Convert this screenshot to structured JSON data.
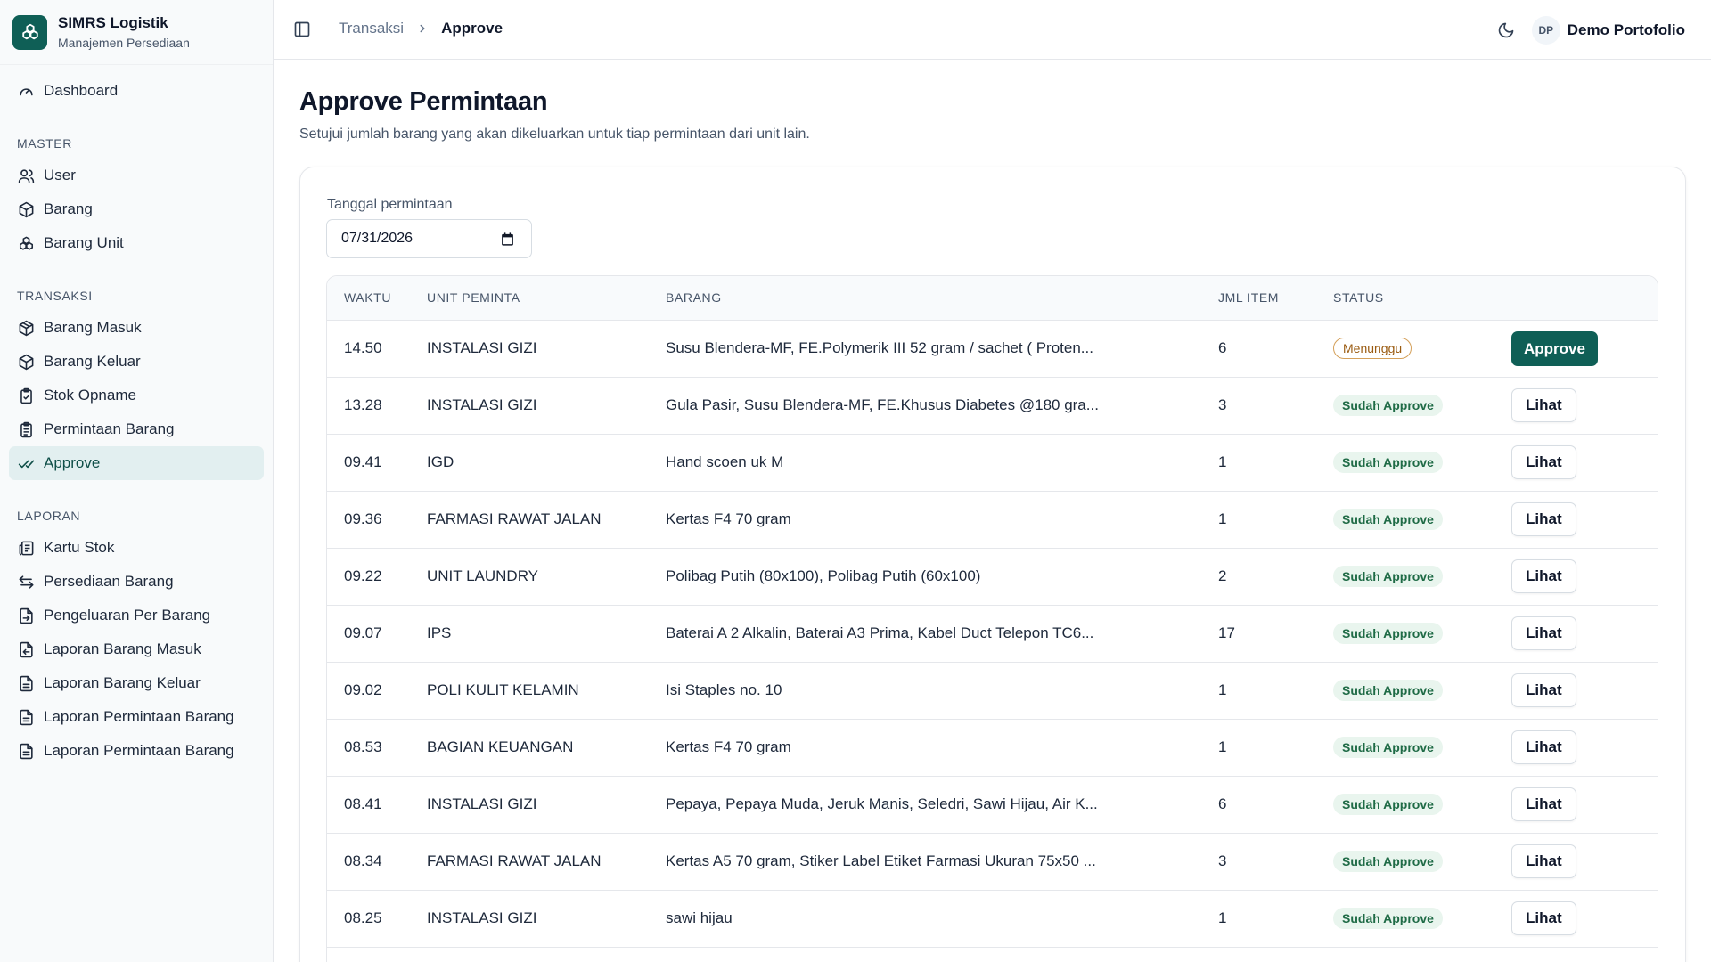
{
  "brand": {
    "title": "SIMRS Logistik",
    "subtitle": "Manajemen Persediaan"
  },
  "sidebar": {
    "dashboard": "Dashboard",
    "sections": {
      "master": "MASTER",
      "transaksi": "TRANSAKSI",
      "laporan": "LAPORAN"
    },
    "master_items": [
      "User",
      "Barang",
      "Barang Unit"
    ],
    "transaksi_items": [
      "Barang Masuk",
      "Barang Keluar",
      "Stok Opname",
      "Permintaan Barang",
      "Approve"
    ],
    "laporan_items": [
      "Kartu Stok",
      "Persediaan Barang",
      "Pengeluaran Per Barang",
      "Laporan Barang Masuk",
      "Laporan Barang Keluar",
      "Laporan Permintaan Barang",
      "Laporan Permintaan Barang"
    ]
  },
  "header": {
    "breadcrumb_prev": "Transaksi",
    "breadcrumb_current": "Approve",
    "user_initials": "DP",
    "user_name": "Demo Portofolio"
  },
  "main": {
    "title": "Approve Permintaan",
    "subtitle": "Setujui jumlah barang yang akan dikeluarkan untuk tiap permintaan dari unit lain.",
    "filter_label": "Tanggal permintaan",
    "filter_value": "07/31/2026"
  },
  "table": {
    "columns": [
      "WAKTU",
      "UNIT PEMINTA",
      "BARANG",
      "JML ITEM",
      "STATUS"
    ],
    "rows": [
      {
        "waktu": "14.50",
        "unit": "INSTALASI GIZI",
        "barang": "Susu Blendera-MF, FE.Polymerik III 52 gram / sachet ( Proten...",
        "jml": "6",
        "status": "Menunggu",
        "action": "Approve"
      },
      {
        "waktu": "13.28",
        "unit": "INSTALASI GIZI",
        "barang": "Gula Pasir, Susu Blendera-MF, FE.Khusus Diabetes @180 gra...",
        "jml": "3",
        "status": "Sudah Approve",
        "action": "Lihat"
      },
      {
        "waktu": "09.41",
        "unit": "IGD",
        "barang": "Hand scoen uk M",
        "jml": "1",
        "status": "Sudah Approve",
        "action": "Lihat"
      },
      {
        "waktu": "09.36",
        "unit": "FARMASI RAWAT JALAN",
        "barang": "Kertas F4 70 gram",
        "jml": "1",
        "status": "Sudah Approve",
        "action": "Lihat"
      },
      {
        "waktu": "09.22",
        "unit": "UNIT LAUNDRY",
        "barang": "Polibag Putih (80x100), Polibag Putih (60x100)",
        "jml": "2",
        "status": "Sudah Approve",
        "action": "Lihat"
      },
      {
        "waktu": "09.07",
        "unit": "IPS",
        "barang": "Baterai A 2 Alkalin, Baterai A3 Prima, Kabel Duct Telepon TC6...",
        "jml": "17",
        "status": "Sudah Approve",
        "action": "Lihat"
      },
      {
        "waktu": "09.02",
        "unit": "POLI KULIT KELAMIN",
        "barang": "Isi Staples no. 10",
        "jml": "1",
        "status": "Sudah Approve",
        "action": "Lihat"
      },
      {
        "waktu": "08.53",
        "unit": "BAGIAN KEUANGAN",
        "barang": "Kertas F4 70 gram",
        "jml": "1",
        "status": "Sudah Approve",
        "action": "Lihat"
      },
      {
        "waktu": "08.41",
        "unit": "INSTALASI GIZI",
        "barang": "Pepaya, Pepaya Muda, Jeruk Manis, Seledri, Sawi Hijau, Air K...",
        "jml": "6",
        "status": "Sudah Approve",
        "action": "Lihat"
      },
      {
        "waktu": "08.34",
        "unit": "FARMASI RAWAT JALAN",
        "barang": "Kertas A5 70 gram, Stiker Label Etiket Farmasi Ukuran 75x50 ...",
        "jml": "3",
        "status": "Sudah Approve",
        "action": "Lihat"
      },
      {
        "waktu": "08.25",
        "unit": "INSTALASI GIZI",
        "barang": "sawi hijau",
        "jml": "1",
        "status": "Sudah Approve",
        "action": "Lihat"
      }
    ]
  },
  "colors": {
    "accent": "#0f5f56",
    "wait": "#9a5b11",
    "ok": "#1f6b46"
  }
}
